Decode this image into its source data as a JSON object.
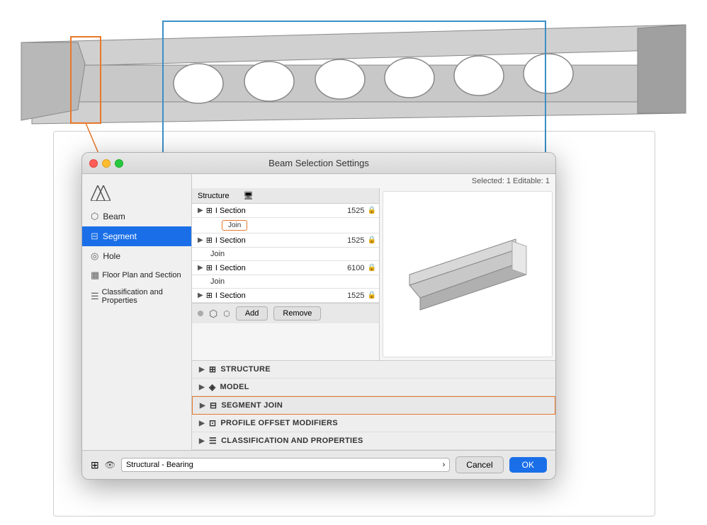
{
  "dialog": {
    "title": "Beam Selection Settings",
    "selected_info": "Selected: 1 Editable: 1",
    "traffic_lights": {
      "red": "close",
      "yellow": "minimize",
      "green": "maximize"
    }
  },
  "sidebar": {
    "items": [
      {
        "id": "beam",
        "label": "Beam",
        "icon": "beam-icon",
        "active": false
      },
      {
        "id": "segment",
        "label": "Segment",
        "icon": "segment-icon",
        "active": true
      },
      {
        "id": "hole",
        "label": "Hole",
        "icon": "hole-icon",
        "active": false
      },
      {
        "id": "floor-plan",
        "label": "Floor Plan and Section",
        "icon": "floor-icon",
        "active": false
      },
      {
        "id": "classification",
        "label": "Classification and Properties",
        "icon": "class-icon",
        "active": false
      }
    ]
  },
  "table": {
    "headers": [
      "Structure",
      "monitor-icon"
    ],
    "rows": [
      {
        "type": "section",
        "expand": true,
        "icon": "i-section-icon",
        "label": "I Section",
        "value": "1525",
        "lock": true
      },
      {
        "type": "join",
        "label": "Join",
        "highlighted": true
      },
      {
        "type": "section",
        "expand": true,
        "icon": "i-section-icon",
        "label": "I Section",
        "value": "1525",
        "lock": true
      },
      {
        "type": "join",
        "label": "Join"
      },
      {
        "type": "section",
        "expand": true,
        "icon": "i-section-icon",
        "label": "I Section",
        "value": "6100",
        "lock": true
      },
      {
        "type": "join",
        "label": "Join"
      },
      {
        "type": "section",
        "expand": true,
        "icon": "i-section-icon",
        "label": "I Section",
        "value": "1525",
        "lock": true
      }
    ],
    "add_label": "Add",
    "remove_label": "Remove"
  },
  "sections": [
    {
      "id": "structure",
      "label": "STRUCTURE",
      "icon": "grid-icon",
      "highlighted": false
    },
    {
      "id": "model",
      "label": "MODEL",
      "icon": "model-icon",
      "highlighted": false
    },
    {
      "id": "segment-join",
      "label": "SEGMENT JOIN",
      "icon": "join-icon",
      "highlighted": true
    },
    {
      "id": "profile-offset",
      "label": "PROFILE OFFSET MODIFIERS",
      "icon": "offset-icon",
      "highlighted": false
    },
    {
      "id": "classification-props",
      "label": "CLASSIFICATION AND PROPERTIES",
      "icon": "props-icon",
      "highlighted": false
    }
  ],
  "footer": {
    "select_label": "Structural - Bearing",
    "cancel_label": "Cancel",
    "ok_label": "OK"
  }
}
